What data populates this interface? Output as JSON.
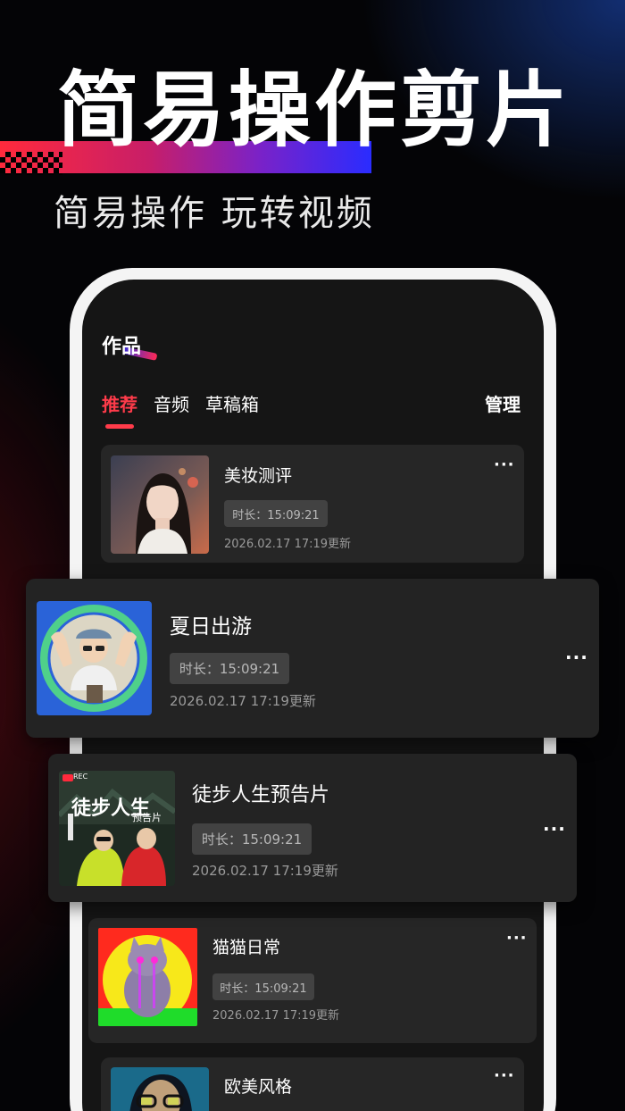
{
  "hero": {
    "title": "简易操作剪片",
    "subtitle": "简易操作 玩转视频"
  },
  "screen": {
    "title": "作品",
    "tabs": [
      {
        "label": "推荐",
        "active": true
      },
      {
        "label": "音频",
        "active": false
      },
      {
        "label": "草稿箱",
        "active": false
      }
    ],
    "manage_label": "管理"
  },
  "works": [
    {
      "title": "美妆测评",
      "duration": "时长：15:09:21",
      "updated": "2026.02.17  17:19更新",
      "more": "···"
    },
    {
      "title": "夏日出游",
      "duration": "时长：15:09:21",
      "updated": "2026.02.17  17:19更新",
      "more": "···"
    },
    {
      "title": "徒步人生预告片",
      "duration": "时长：15:09:21",
      "updated": "2026.02.17  17:19更新",
      "more": "···",
      "thumb_text": {
        "main": "徒步人生",
        "tag": "预告片",
        "rec": "REC"
      }
    },
    {
      "title": "猫猫日常",
      "duration": "时长：15:09:21",
      "updated": "2026.02.17  17:19更新",
      "more": "···"
    },
    {
      "title": "欧美风格",
      "more": "···"
    }
  ],
  "colors": {
    "accent_red": "#ff3b4a",
    "card_bg": "#262626",
    "phone_frame": "#f4f4f4"
  }
}
